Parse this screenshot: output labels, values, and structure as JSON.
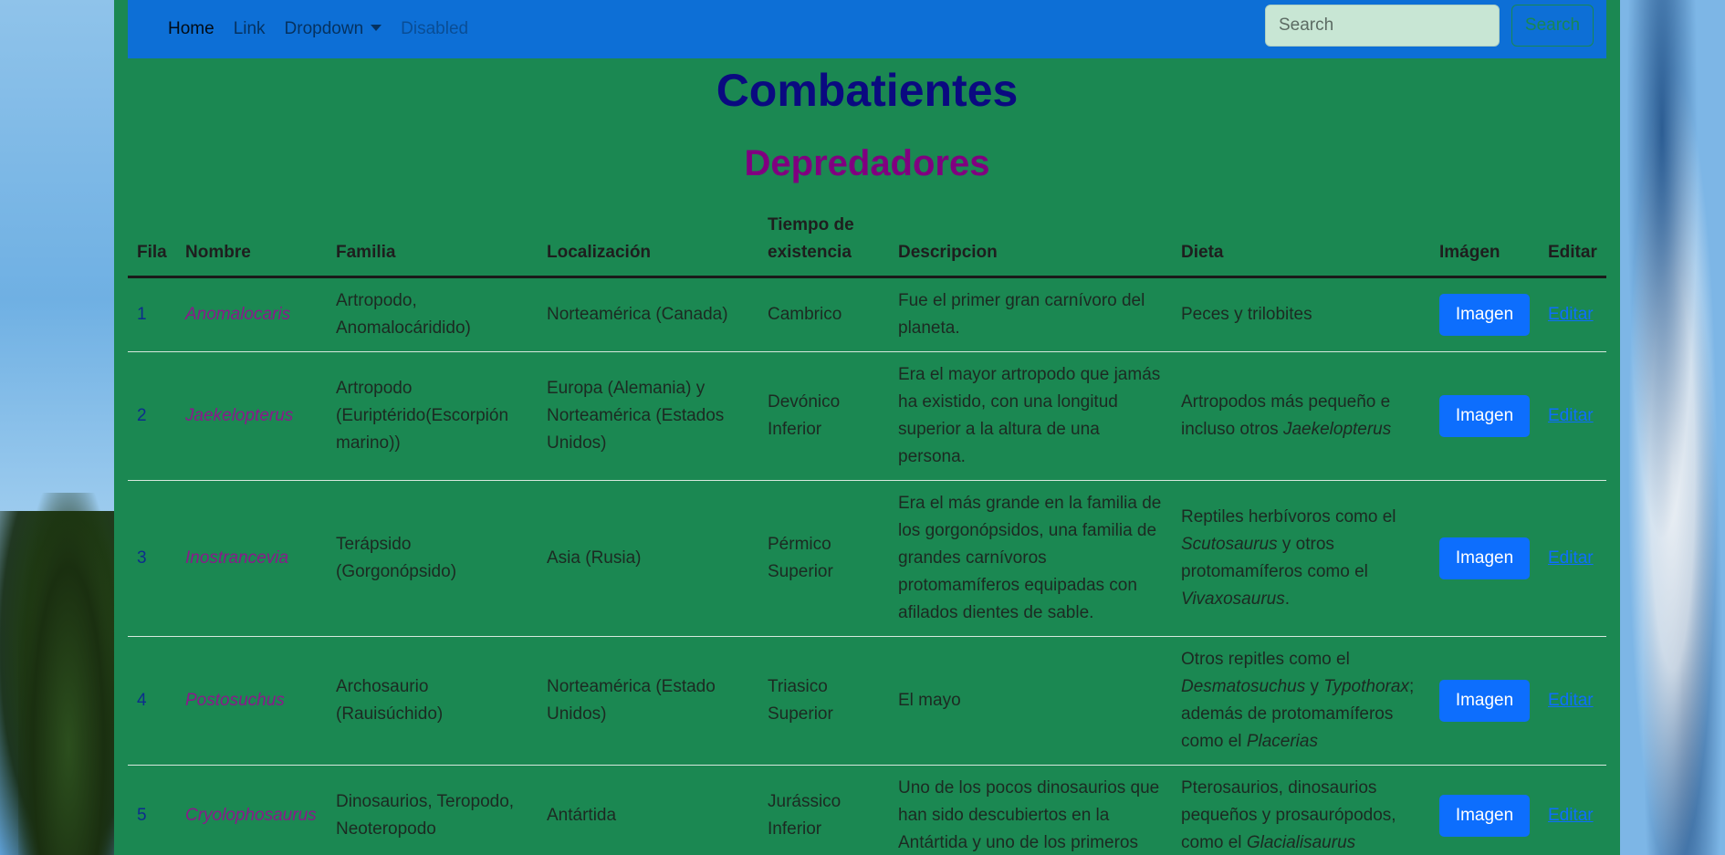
{
  "nav": {
    "items": [
      "Home",
      "Link",
      "Dropdown",
      "Disabled"
    ],
    "search_placeholder": "Search",
    "search_button": "Search"
  },
  "page": {
    "title": "Combatientes",
    "subtitle": "Depredadores"
  },
  "table": {
    "headers": [
      "Fila",
      "Nombre",
      "Familia",
      "Localización",
      "Tiempo de existencia",
      "Descripcion",
      "Dieta",
      "Imágen",
      "Editar"
    ],
    "rows": [
      {
        "fila": "1",
        "nombre": "Anomalocaris",
        "familia": "Artropodo, Anomalocáridido)",
        "localizacion": "Norteamérica (Canada)",
        "tiempo": "Cambrico",
        "descripcion": "Fue el primer gran carnívoro del planeta.",
        "dieta": [
          {
            "t": "Peces y trilobites",
            "i": false
          }
        ],
        "imagen": "Imagen",
        "editar": "Editar"
      },
      {
        "fila": "2",
        "nombre": "Jaekelopterus",
        "familia": "Artropodo (Euriptérido(Escorpión marino))",
        "localizacion": "Europa (Alemania) y Norteamérica (Estados Unidos)",
        "tiempo": "Devónico Inferior",
        "descripcion": "Era el mayor artropodo que jamás ha existido, con una longitud superior a la altura de una persona.",
        "dieta": [
          {
            "t": "Artropodos más pequeño e incluso otros ",
            "i": false
          },
          {
            "t": "Jaekelopterus",
            "i": true
          }
        ],
        "imagen": "Imagen",
        "editar": "Editar"
      },
      {
        "fila": "3",
        "nombre": "Inostrancevia",
        "familia": "Terápsido (Gorgonópsido)",
        "localizacion": "Asia (Rusia)",
        "tiempo": "Pérmico Superior",
        "descripcion": "Era el más grande en la familia de los gorgonópsidos, una familia de grandes carnívoros protomamíferos equipadas con afilados dientes de sable.",
        "dieta": [
          {
            "t": "Reptiles herbívoros como el ",
            "i": false
          },
          {
            "t": "Scutosaurus",
            "i": true
          },
          {
            "t": " y otros protomamíferos como el ",
            "i": false
          },
          {
            "t": "Vivaxosaurus",
            "i": true
          },
          {
            "t": ".",
            "i": false
          }
        ],
        "imagen": "Imagen",
        "editar": "Editar"
      },
      {
        "fila": "4",
        "nombre": "Postosuchus",
        "familia": "Archosaurio (Rauisúchido)",
        "localizacion": "Norteamérica (Estado Unidos)",
        "tiempo": "Triasico Superior",
        "descripcion": "El mayo",
        "dieta": [
          {
            "t": "Otros repitles como el ",
            "i": false
          },
          {
            "t": "Desmatosuchus",
            "i": true
          },
          {
            "t": " y ",
            "i": false
          },
          {
            "t": "Typothorax",
            "i": true
          },
          {
            "t": "; además de protomamíferos como el ",
            "i": false
          },
          {
            "t": "Placerias",
            "i": true
          }
        ],
        "imagen": "Imagen",
        "editar": "Editar"
      },
      {
        "fila": "5",
        "nombre": "Cryolophosaurus",
        "familia": "Dinosaurios, Teropodo, Neoteropodo",
        "localizacion": "Antártida",
        "tiempo": "Jurássico Inferior",
        "descripcion": "Uno de los pocos dinosaurios que han sido descubiertos en la Antártida y uno de los primeros",
        "dieta": [
          {
            "t": "Pterosaurios, dinosaurios pequeños y prosaurópodos, como el ",
            "i": false
          },
          {
            "t": "Glacialisaurus",
            "i": true
          }
        ],
        "imagen": "Imagen",
        "editar": "Editar"
      }
    ]
  }
}
